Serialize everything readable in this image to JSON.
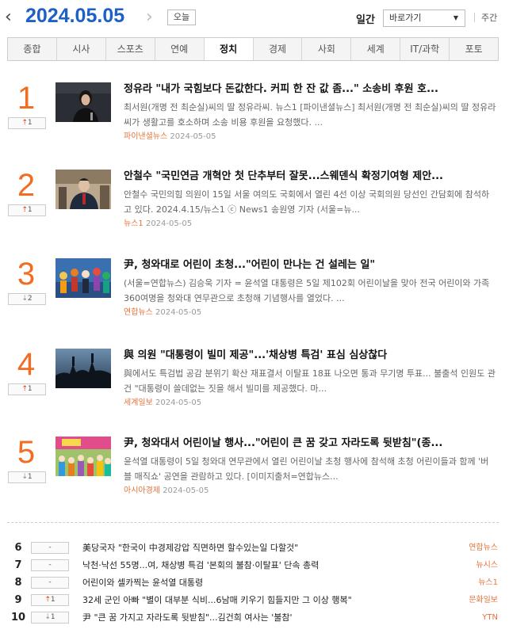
{
  "header": {
    "date": "2024.05.05",
    "prev_icon": "‹",
    "next_icon": "›",
    "today_label": "오늘",
    "period_daily": "일간",
    "goto_label": "바로가기",
    "period_weekly": "주간"
  },
  "tabs": [
    {
      "label": "종합",
      "active": false
    },
    {
      "label": "시사",
      "active": false
    },
    {
      "label": "스포츠",
      "active": false
    },
    {
      "label": "연예",
      "active": false
    },
    {
      "label": "정치",
      "active": true
    },
    {
      "label": "경제",
      "active": false
    },
    {
      "label": "사회",
      "active": false
    },
    {
      "label": "세계",
      "active": false
    },
    {
      "label": "IT/과학",
      "active": false
    },
    {
      "label": "포토",
      "active": false
    }
  ],
  "top_items": [
    {
      "rank": "1",
      "change_dir": "up",
      "change": "1",
      "title": "정유라 \"내가 국힘보다 돈값한다. 커피 한 잔 값 좀...\" 소송비 후원 호...",
      "summary": "최서원(개명 전 최순실)씨의 딸 정유라씨. 뉴스1 [파이낸셜뉴스] 최서원(개명 전 최순실)씨의 딸 정유라씨가 생활고를 호소하며 소송 비용 후원을 요청했다. ...",
      "source": "파이낸셜뉴스",
      "date": "2024-05-05"
    },
    {
      "rank": "2",
      "change_dir": "up",
      "change": "1",
      "title": "안철수 \"국민연금 개혁안 첫 단추부터 잘못...스웨덴식 확정기여형 제안...",
      "summary": "안철수 국민의힘 의원이 15일 서울 여의도 국회에서 열린 4선 이상 국회의원 당선인 간담회에 참석하고 있다. 2024.4.15/뉴스1 ⓒ News1 송원영 기자 (서울=뉴...",
      "source": "뉴스1",
      "date": "2024-05-05"
    },
    {
      "rank": "3",
      "change_dir": "down",
      "change": "2",
      "title": "尹, 청와대로 어린이 초청...\"어린이 만나는 건 설레는 일\"",
      "summary": "(서울=연합뉴스) 김승욱 기자 = 윤석열 대통령은 5일 제102회 어린이날을 맞아 전국 어린이와 가족 360여명을 청와대 연무관으로 초청해 기념행사를 열었다. ...",
      "source": "연합뉴스",
      "date": "2024-05-05"
    },
    {
      "rank": "4",
      "change_dir": "up",
      "change": "1",
      "title": "與 의원 \"대통령이 빌미 제공\"...'채상병 특검' 표심 심상찮다",
      "summary": "與에서도 특검법 공감 분위기 확산 재표결서 이탈표 18표 나오면 통과 무기명 투표... 불출석 인원도 관건 \"대통령이 쓸데없는 짓을 해서 빌미를 제공했다. 마...",
      "source": "세계일보",
      "date": "2024-05-05"
    },
    {
      "rank": "5",
      "change_dir": "down",
      "change": "1",
      "title": "尹, 청와대서 어린이날 행사...\"어린이 큰 꿈 갖고 자라도록 뒷받침\"(종...",
      "summary": "윤석열 대통령이 5일 청와대 연무관에서 열린 어린이날 초청 행사에 참석해 초청 어린이들과 함께 '버블 매직쇼' 공연을 관람하고 있다. [이미지출처=연합뉴스...",
      "source": "아시아경제",
      "date": "2024-05-05"
    }
  ],
  "list_items": [
    {
      "rank": "6",
      "change_dir": "same",
      "change": "-",
      "title": "美당국자 \"한국이 中경제강압 직면하면 할수있는일 다할것\"",
      "source": "연합뉴스"
    },
    {
      "rank": "7",
      "change_dir": "same",
      "change": "-",
      "title": "낙천·낙선 55명...여, 채상병 특검 '본회의 불참·이탈표' 단속 총력",
      "source": "뉴시스"
    },
    {
      "rank": "8",
      "change_dir": "same",
      "change": "-",
      "title": "어린이와 셀카찍는 윤석열 대통령",
      "source": "뉴스1"
    },
    {
      "rank": "9",
      "change_dir": "up",
      "change": "1",
      "title": "32세 군인 아빠 \"별이 대부분 식비...6남매 키우기 힘들지만 그 이상 행복\"",
      "source": "문화일보"
    },
    {
      "rank": "10",
      "change_dir": "down",
      "change": "1",
      "title": "尹 \"큰 꿈 가지고 자라도록 뒷받침\"...김건희 여사는 '불참'",
      "source": "YTN"
    }
  ],
  "colors": {
    "accent_blue": "#1e5fc8",
    "rank_orange": "#f26d21",
    "source_orange": "#e3743c"
  },
  "icons": {
    "up": "up-arrow-icon",
    "down": "down-arrow-icon"
  }
}
